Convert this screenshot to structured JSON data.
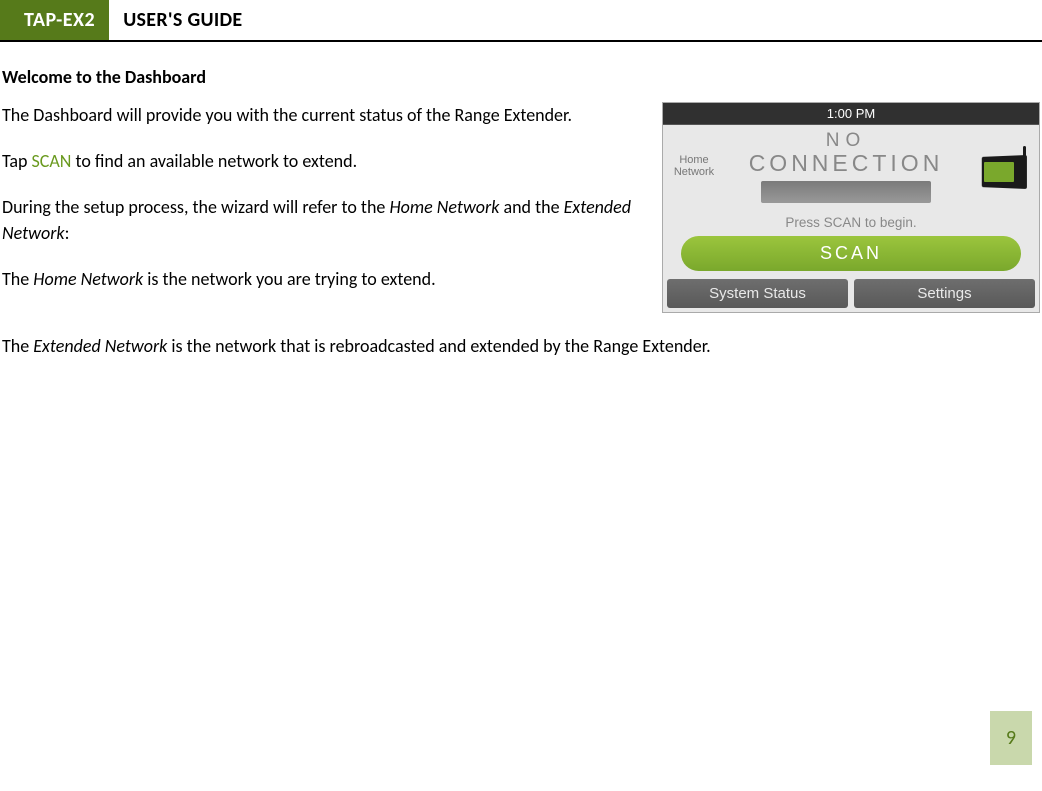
{
  "header": {
    "tag": "TAP-EX2",
    "title": "USER'S GUIDE"
  },
  "section_heading": "Welcome to the Dashboard",
  "paragraphs": {
    "p1": "The Dashboard will provide you with the current status of the Range Extender.",
    "p2_pre": "Tap ",
    "p2_scan": "SCAN",
    "p2_post": " to find an available network to extend.",
    "p3_pre": "During the setup process, the wizard will refer to the ",
    "p3_hn": "Home Network",
    "p3_mid": " and the ",
    "p3_en": "Extended Network",
    "p3_post": ":",
    "p4_pre": "The ",
    "p4_hn": "Home Network",
    "p4_post": " is the network you are trying to extend.",
    "p5_pre": "The ",
    "p5_en": "Extended Network",
    "p5_post": " is the network that is rebroadcasted and extended by the Range Extender."
  },
  "dashboard": {
    "time": "1:00 PM",
    "home_label_l1": "Home",
    "home_label_l2": "Network",
    "noconn_top": "NO",
    "noconn_bottom": "CONNECTION",
    "prompt": "Press SCAN to begin.",
    "scan_button": "SCAN",
    "system_status": "System Status",
    "settings": "Settings"
  },
  "page_number": "9"
}
